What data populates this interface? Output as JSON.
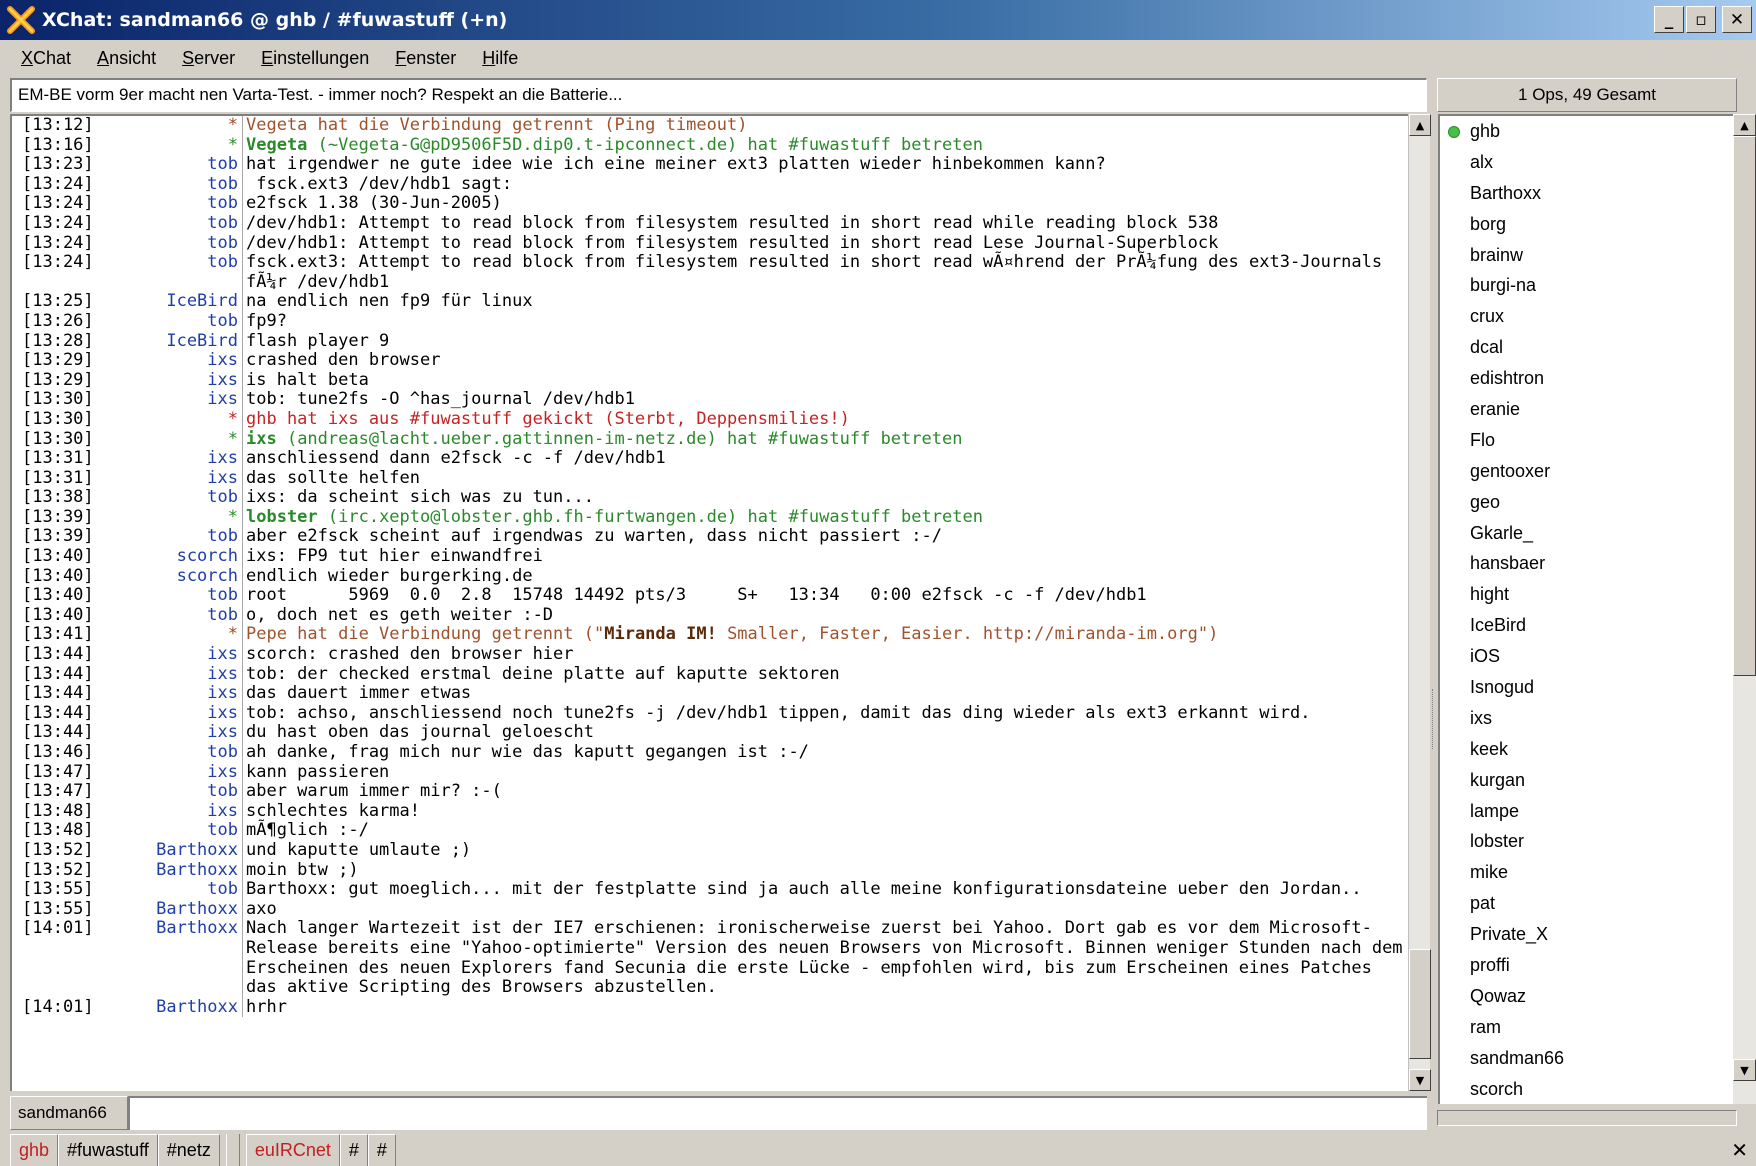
{
  "window": {
    "title": "XChat: sandman66 @ ghb / #fuwastuff (+n)",
    "min_label": "_",
    "max_label": "▫",
    "close_label": "✕"
  },
  "menu": [
    {
      "acc": "X",
      "rest": "Chat"
    },
    {
      "acc": "A",
      "rest": "nsicht"
    },
    {
      "acc": "S",
      "rest": "erver"
    },
    {
      "acc": "E",
      "rest": "instellungen"
    },
    {
      "acc": "F",
      "rest": "enster"
    },
    {
      "acc": "H",
      "rest": "ilfe"
    }
  ],
  "topic": "EM-BE vorm 9er macht nen Varta-Test. - immer noch? Respekt an die Batterie...",
  "user_count": "1 Ops, 49 Gesamt",
  "chat": [
    {
      "ts": "[13:12]",
      "nick": "*",
      "type": "quit",
      "hl": "",
      "msg": "Vegeta hat die Verbindung getrennt (Ping timeout)"
    },
    {
      "ts": "[13:16]",
      "nick": "*",
      "type": "join",
      "hl": "Vegeta",
      "msg": " (~Vegeta-G@pD9506F5D.dip0.t-ipconnect.de) hat #fuwastuff betreten"
    },
    {
      "ts": "[13:23]",
      "nick": "tob",
      "type": "",
      "hl": "",
      "msg": "hat irgendwer ne gute idee wie ich eine meiner ext3 platten wieder hinbekommen kann?"
    },
    {
      "ts": "[13:24]",
      "nick": "tob",
      "type": "",
      "hl": "",
      "msg": " fsck.ext3 /dev/hdb1 sagt:"
    },
    {
      "ts": "[13:24]",
      "nick": "tob",
      "type": "",
      "hl": "",
      "msg": "e2fsck 1.38 (30-Jun-2005)"
    },
    {
      "ts": "[13:24]",
      "nick": "tob",
      "type": "",
      "hl": "",
      "msg": "/dev/hdb1: Attempt to read block from filesystem resulted in short read while reading block 538"
    },
    {
      "ts": "[13:24]",
      "nick": "tob",
      "type": "",
      "hl": "",
      "msg": "/dev/hdb1: Attempt to read block from filesystem resulted in short read Lese Journal-Superblock"
    },
    {
      "ts": "[13:24]",
      "nick": "tob",
      "type": "",
      "hl": "",
      "msg": "fsck.ext3: Attempt to read block from filesystem resulted in short read wÃ¤hrend der PrÃ¼fung des ext3-Journals fÃ¼r /dev/hdb1"
    },
    {
      "ts": "[13:25]",
      "nick": "IceBird",
      "type": "",
      "hl": "",
      "msg": "na endlich nen fp9 für linux"
    },
    {
      "ts": "[13:26]",
      "nick": "tob",
      "type": "",
      "hl": "",
      "msg": "fp9?"
    },
    {
      "ts": "[13:28]",
      "nick": "IceBird",
      "type": "",
      "hl": "",
      "msg": "flash player 9"
    },
    {
      "ts": "[13:29]",
      "nick": "ixs",
      "type": "",
      "hl": "",
      "msg": "crashed den browser"
    },
    {
      "ts": "[13:29]",
      "nick": "ixs",
      "type": "",
      "hl": "",
      "msg": "is halt beta"
    },
    {
      "ts": "[13:30]",
      "nick": "ixs",
      "type": "",
      "hl": "",
      "msg": "tob: tune2fs -O ^has_journal /dev/hdb1"
    },
    {
      "ts": "[13:30]",
      "nick": "*",
      "type": "kick",
      "hl": "",
      "msg": "ghb hat ixs aus #fuwastuff gekickt (Sterbt, Deppensmilies!)"
    },
    {
      "ts": "[13:30]",
      "nick": "*",
      "type": "join",
      "hl": "ixs",
      "msg": " (andreas@lacht.ueber.gattinnen-im-netz.de) hat #fuwastuff betreten"
    },
    {
      "ts": "[13:31]",
      "nick": "ixs",
      "type": "",
      "hl": "",
      "msg": "anschliessend dann e2fsck -c -f /dev/hdb1"
    },
    {
      "ts": "[13:31]",
      "nick": "ixs",
      "type": "",
      "hl": "",
      "msg": "das sollte helfen"
    },
    {
      "ts": "[13:38]",
      "nick": "tob",
      "type": "",
      "hl": "",
      "msg": "ixs: da scheint sich was zu tun..."
    },
    {
      "ts": "[13:39]",
      "nick": "*",
      "type": "join",
      "hl": "lobster",
      "msg": " (irc.xepto@lobster.ghb.fh-furtwangen.de) hat #fuwastuff betreten"
    },
    {
      "ts": "[13:39]",
      "nick": "tob",
      "type": "",
      "hl": "",
      "msg": "aber e2fsck scheint auf irgendwas zu warten, dass nicht passiert :-/"
    },
    {
      "ts": "[13:40]",
      "nick": "scorch",
      "type": "",
      "hl": "",
      "msg": "ixs: FP9 tut hier einwandfrei"
    },
    {
      "ts": "[13:40]",
      "nick": "scorch",
      "type": "",
      "hl": "",
      "msg": "endlich wieder burgerking.de"
    },
    {
      "ts": "[13:40]",
      "nick": "tob",
      "type": "",
      "hl": "",
      "msg": "root      5969  0.0  2.8  15748 14492 pts/3     S+   13:34   0:00 e2fsck -c -f /dev/hdb1"
    },
    {
      "ts": "[13:40]",
      "nick": "tob",
      "type": "",
      "hl": "",
      "msg": "o, doch net es geth weiter :-D"
    },
    {
      "ts": "[13:41]",
      "nick": "*",
      "type": "quit",
      "hl": "",
      "msg": "Pepe hat die Verbindung getrennt (\"",
      "hl2": "Miranda IM!",
      "msg2": " Smaller, Faster, Easier. http://miranda-im.org\")"
    },
    {
      "ts": "[13:44]",
      "nick": "ixs",
      "type": "",
      "hl": "",
      "msg": "scorch: crashed den browser hier"
    },
    {
      "ts": "[13:44]",
      "nick": "ixs",
      "type": "",
      "hl": "",
      "msg": "tob: der checked erstmal deine platte auf kaputte sektoren"
    },
    {
      "ts": "[13:44]",
      "nick": "ixs",
      "type": "",
      "hl": "",
      "msg": "das dauert immer etwas"
    },
    {
      "ts": "[13:44]",
      "nick": "ixs",
      "type": "",
      "hl": "",
      "msg": "tob: achso, anschliessend noch tune2fs -j /dev/hdb1 tippen, damit das ding wieder als ext3 erkannt wird."
    },
    {
      "ts": "[13:44]",
      "nick": "ixs",
      "type": "",
      "hl": "",
      "msg": "du hast oben das journal geloescht"
    },
    {
      "ts": "[13:46]",
      "nick": "tob",
      "type": "",
      "hl": "",
      "msg": "ah danke, frag mich nur wie das kaputt gegangen ist :-/"
    },
    {
      "ts": "[13:47]",
      "nick": "ixs",
      "type": "",
      "hl": "",
      "msg": "kann passieren"
    },
    {
      "ts": "[13:47]",
      "nick": "tob",
      "type": "",
      "hl": "",
      "msg": "aber warum immer mir? :-("
    },
    {
      "ts": "[13:48]",
      "nick": "ixs",
      "type": "",
      "hl": "",
      "msg": "schlechtes karma!"
    },
    {
      "ts": "[13:48]",
      "nick": "tob",
      "type": "",
      "hl": "",
      "msg": "mÃ¶glich :-/"
    },
    {
      "ts": "[13:52]",
      "nick": "Barthoxx",
      "type": "",
      "hl": "",
      "msg": "und kaputte umlaute ;)"
    },
    {
      "ts": "[13:52]",
      "nick": "Barthoxx",
      "type": "",
      "hl": "",
      "msg": "moin btw ;)"
    },
    {
      "ts": "[13:55]",
      "nick": "tob",
      "type": "",
      "hl": "",
      "msg": "Barthoxx: gut moeglich... mit der festplatte sind ja auch alle meine konfigurationsdateine ueber den Jordan.."
    },
    {
      "ts": "[13:55]",
      "nick": "Barthoxx",
      "type": "",
      "hl": "",
      "msg": "axo"
    },
    {
      "ts": "[14:01]",
      "nick": "Barthoxx",
      "type": "",
      "hl": "",
      "msg": "Nach langer Wartezeit ist der IE7 erschienen: ironischerweise zuerst bei Yahoo. Dort gab es vor dem Microsoft-Release bereits eine \"Yahoo-optimierte\" Version des neuen Browsers von Microsoft. Binnen weniger Stunden nach dem Erscheinen des neuen Explorers fand Secunia die erste Lücke - empfohlen wird, bis zum Erscheinen eines Patches das aktive Scripting des Browsers abzustellen."
    },
    {
      "ts": "[14:01]",
      "nick": "Barthoxx",
      "type": "",
      "hl": "",
      "msg": "hrhr"
    }
  ],
  "users": [
    {
      "name": "ghb",
      "op": true
    },
    {
      "name": "alx",
      "op": false
    },
    {
      "name": "Barthoxx",
      "op": false
    },
    {
      "name": "borg",
      "op": false
    },
    {
      "name": "brainw",
      "op": false
    },
    {
      "name": "burgi-na",
      "op": false
    },
    {
      "name": "crux",
      "op": false
    },
    {
      "name": "dcal",
      "op": false
    },
    {
      "name": "edishtron",
      "op": false
    },
    {
      "name": "eranie",
      "op": false
    },
    {
      "name": "Flo",
      "op": false
    },
    {
      "name": "gentooxer",
      "op": false
    },
    {
      "name": "geo",
      "op": false
    },
    {
      "name": "Gkarle_",
      "op": false
    },
    {
      "name": "hansbaer",
      "op": false
    },
    {
      "name": "hight",
      "op": false
    },
    {
      "name": "IceBird",
      "op": false
    },
    {
      "name": "iOS",
      "op": false
    },
    {
      "name": "Isnogud",
      "op": false
    },
    {
      "name": "ixs",
      "op": false
    },
    {
      "name": "keek",
      "op": false
    },
    {
      "name": "kurgan",
      "op": false
    },
    {
      "name": "lampe",
      "op": false
    },
    {
      "name": "lobster",
      "op": false
    },
    {
      "name": "mike",
      "op": false
    },
    {
      "name": "pat",
      "op": false
    },
    {
      "name": "Private_X",
      "op": false
    },
    {
      "name": "proffi",
      "op": false
    },
    {
      "name": "Qowaz",
      "op": false
    },
    {
      "name": "ram",
      "op": false
    },
    {
      "name": "sandman66",
      "op": false
    },
    {
      "name": "scorch",
      "op": false
    }
  ],
  "input": {
    "nick": "sandman66",
    "value": ""
  },
  "tabs": [
    {
      "label": "ghb",
      "kind": "server"
    },
    {
      "label": "#fuwastuff",
      "kind": "channel"
    },
    {
      "label": "#netz",
      "kind": "channel"
    },
    {
      "label": "euIRCnet",
      "kind": "server"
    },
    {
      "label": "#",
      "kind": "channel"
    },
    {
      "label": "#",
      "kind": "channel"
    }
  ],
  "tab_close_label": "✕",
  "colors": {
    "op_indicator": "#48c048",
    "join": "#2a8a2a",
    "quit": "#a0522d",
    "kick": "#c42424",
    "nick": "#1f3ea8"
  }
}
